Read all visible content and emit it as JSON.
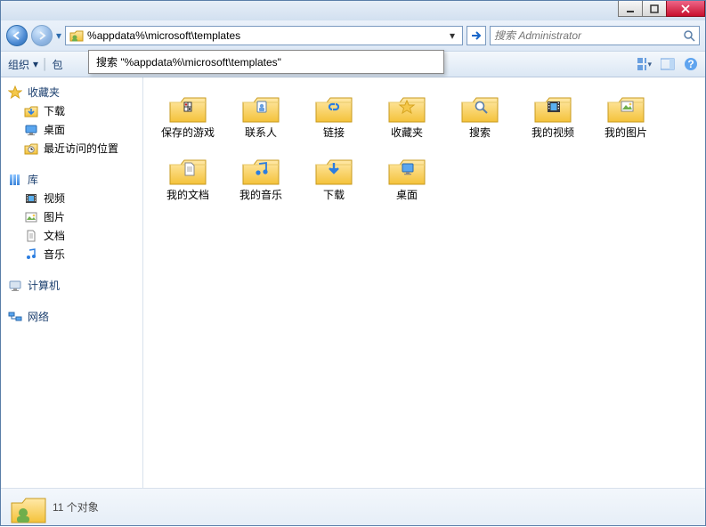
{
  "titlebar": {},
  "nav": {
    "address_value": "%appdata%\\microsoft\\templates",
    "search_placeholder": "搜索 Administrator",
    "suggestion_text": "搜索 \"%appdata%\\microsoft\\templates\""
  },
  "toolbar": {
    "organize_label": "组织",
    "include_prefix": "包"
  },
  "sidebar": {
    "favorites": {
      "label": "收藏夹",
      "items": [
        {
          "label": "下载",
          "icon": "download-icon"
        },
        {
          "label": "桌面",
          "icon": "desktop-icon"
        },
        {
          "label": "最近访问的位置",
          "icon": "recent-icon"
        }
      ]
    },
    "libraries": {
      "label": "库",
      "items": [
        {
          "label": "视频",
          "icon": "video-icon"
        },
        {
          "label": "图片",
          "icon": "picture-icon"
        },
        {
          "label": "文档",
          "icon": "document-icon"
        },
        {
          "label": "音乐",
          "icon": "music-icon"
        }
      ]
    },
    "computer": {
      "label": "计算机"
    },
    "network": {
      "label": "网络"
    }
  },
  "folders": [
    {
      "label": "保存的游戏",
      "overlay": "game"
    },
    {
      "label": "联系人",
      "overlay": "contact"
    },
    {
      "label": "链接",
      "overlay": "link"
    },
    {
      "label": "收藏夹",
      "overlay": "star"
    },
    {
      "label": "搜索",
      "overlay": "search"
    },
    {
      "label": "我的视频",
      "overlay": "video"
    },
    {
      "label": "我的图片",
      "overlay": "picture"
    },
    {
      "label": "我的文档",
      "overlay": "doc"
    },
    {
      "label": "我的音乐",
      "overlay": "music"
    },
    {
      "label": "下载",
      "overlay": "download"
    },
    {
      "label": "桌面",
      "overlay": "desktop"
    }
  ],
  "status": {
    "count_text": "11 个对象"
  }
}
